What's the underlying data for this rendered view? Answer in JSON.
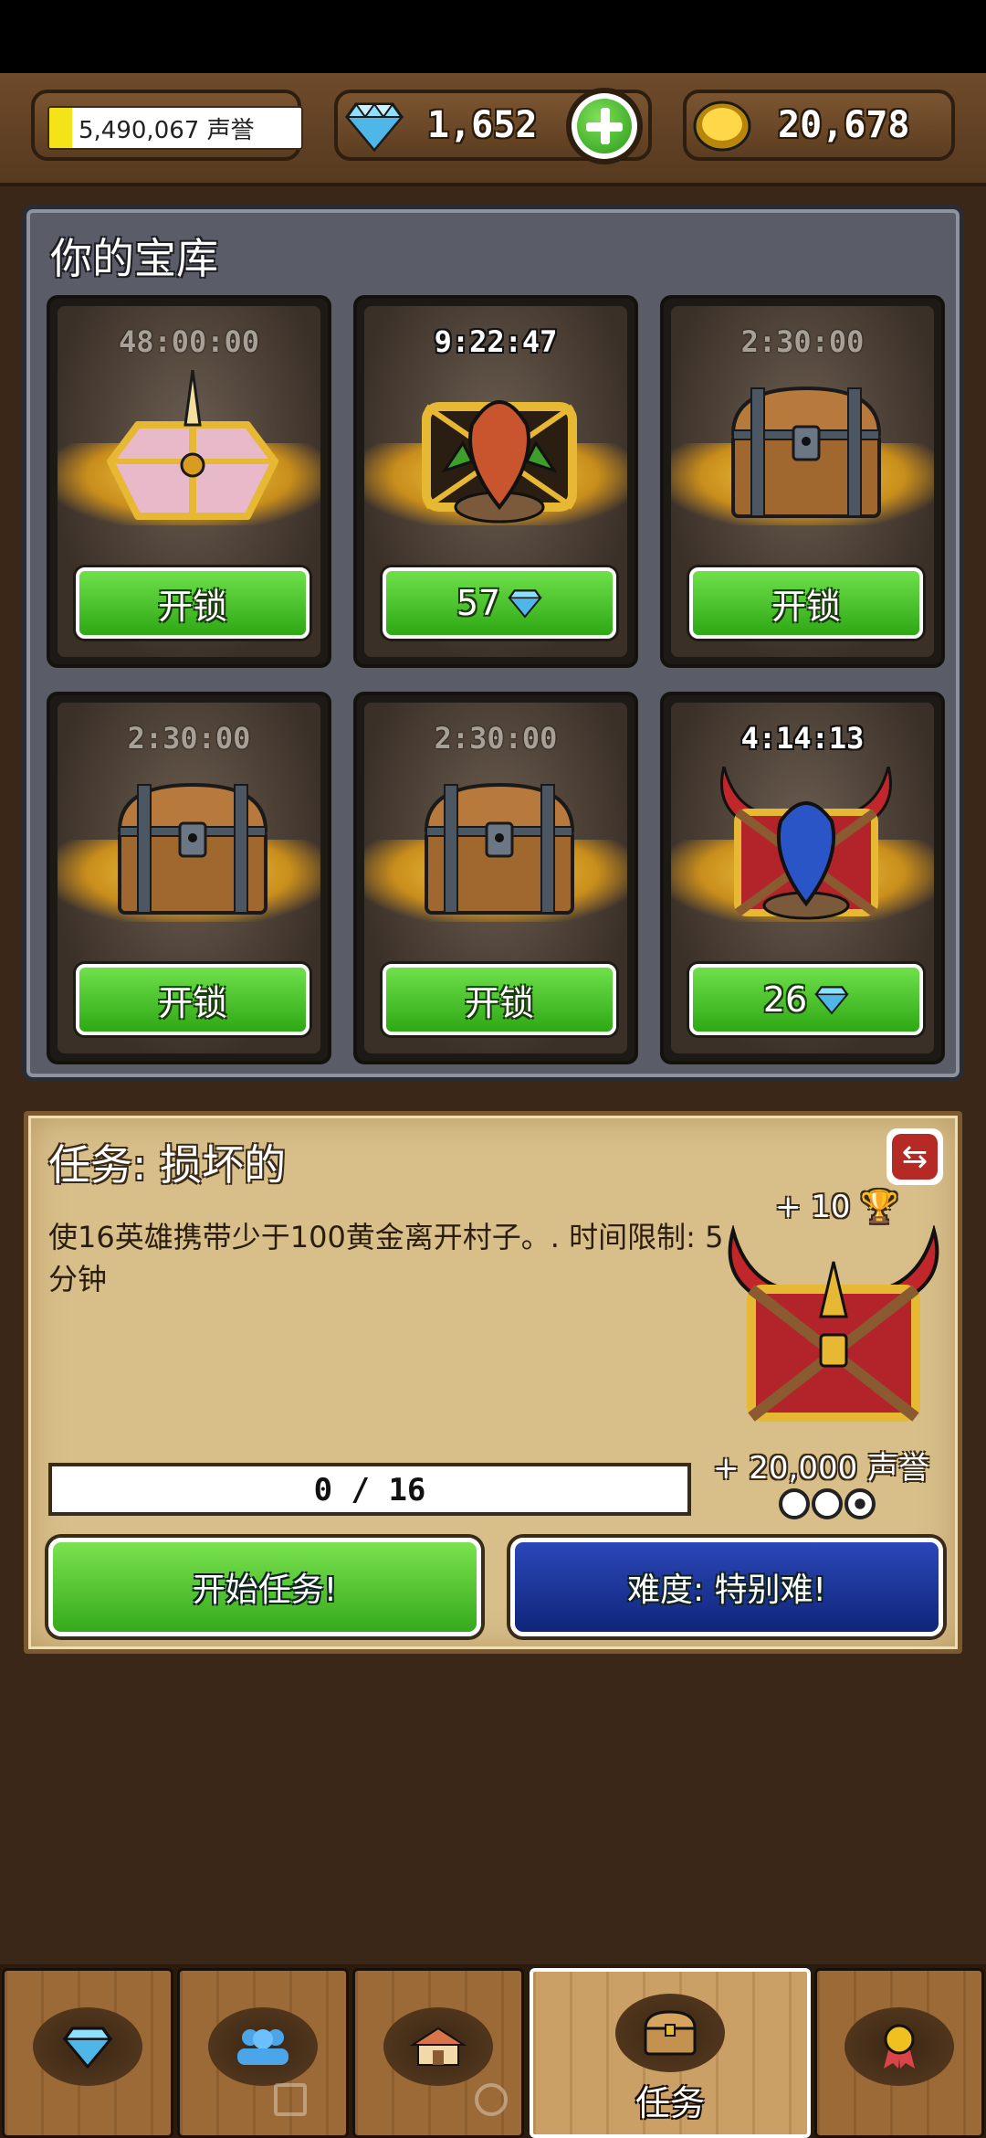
{
  "header": {
    "reputation": {
      "text": "5,490,067 声誉",
      "fill_fraction": 0.09
    },
    "gems": {
      "value": "1,652",
      "icon": "diamond-icon"
    },
    "add_button_icon": "plus-icon",
    "gold": {
      "value": "20,678",
      "icon": "gold-coin-icon"
    }
  },
  "vault": {
    "title": "你的宝库",
    "chests": [
      {
        "timer": "48:00:00",
        "timer_active": false,
        "chest": "unicorn-chest-icon",
        "button": "开锁",
        "gem_cost": false
      },
      {
        "timer": "9:22:47",
        "timer_active": true,
        "chest": "goblin-opening-chest-icon",
        "button": "57",
        "gem_cost": true
      },
      {
        "timer": "2:30:00",
        "timer_active": false,
        "chest": "wooden-chest-icon",
        "button": "开锁",
        "gem_cost": false
      },
      {
        "timer": "2:30:00",
        "timer_active": false,
        "chest": "wooden-chest-icon",
        "button": "开锁",
        "gem_cost": false
      },
      {
        "timer": "2:30:00",
        "timer_active": false,
        "chest": "wooden-chest-icon",
        "button": "开锁",
        "gem_cost": false
      },
      {
        "timer": "4:14:13",
        "timer_active": true,
        "chest": "goblin-horned-chest-icon",
        "button": "26",
        "gem_cost": true
      }
    ]
  },
  "quest": {
    "title": "任务: 损坏的",
    "description": "使16英雄携带少于100黄金离开村子。. 时间限制: 5分钟",
    "trophy_reward": "+ 10",
    "reputation_reward": "+ 20,000 声誉",
    "stars_filled": 1,
    "stars_total": 3,
    "progress": {
      "text": "0 / 16",
      "current": 0,
      "total": 16
    },
    "start_button": "开始任务!",
    "difficulty_button": "难度: 特别难!"
  },
  "navbar": {
    "tabs": [
      {
        "icon": "diamond-shop-icon",
        "label": ""
      },
      {
        "icon": "heroes-icon",
        "label": ""
      },
      {
        "icon": "village-icon",
        "label": ""
      },
      {
        "icon": "treasure-chest-icon",
        "label": "任务",
        "active": true
      },
      {
        "icon": "medal-icon",
        "label": ""
      }
    ]
  },
  "colors": {
    "accent_green": "#3fb81f",
    "accent_blue": "#10257a",
    "wood": "#6e4a2a"
  }
}
